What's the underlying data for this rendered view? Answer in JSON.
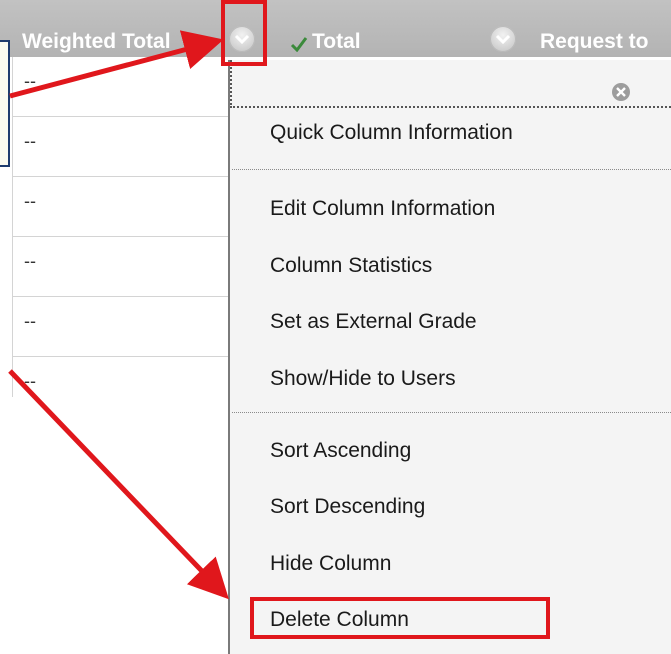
{
  "header": {
    "weighted_total": "Weighted Total",
    "total": "Total",
    "request": "Request to"
  },
  "rows": [
    "--",
    "--",
    "--",
    "--",
    "--",
    "--"
  ],
  "menu": {
    "items": [
      "Quick Column Information",
      "Edit Column Information",
      "Column Statistics",
      "Set as External Grade",
      "Show/Hide to Users",
      "Sort Ascending",
      "Sort Descending",
      "Hide Column",
      "Delete Column"
    ]
  },
  "colors": {
    "highlight": "#e0171c",
    "header_bg": "#b8b8b8",
    "menu_bg": "#f4f4f4"
  },
  "icons": [
    "chevron-down-icon",
    "checkmark-icon",
    "close-icon"
  ]
}
